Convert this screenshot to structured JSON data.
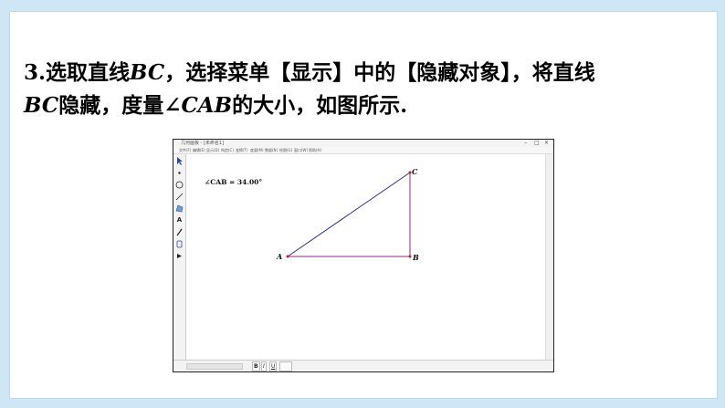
{
  "caption": {
    "num": "3.",
    "t1": "选取直线",
    "bc1": "BC",
    "t2": "，选择菜单【显示】中的【隐藏对象】，将直线",
    "bc2": "BC",
    "t3": "隐藏，度量∠",
    "cab": "CAB",
    "t4": "的大小，如图所示."
  },
  "window": {
    "title": "几何画板 - [未命名1]",
    "minimize": "–",
    "restore": "□",
    "close": "×",
    "menus": [
      "文件(F)",
      "编辑(E)",
      "显示(D)",
      "构造(C)",
      "变换(T)",
      "度量(M)",
      "数据(N)",
      "绘图(G)",
      "窗口(W)",
      "帮助(H)"
    ]
  },
  "tools": {
    "text_tool": "A"
  },
  "measurement": {
    "label": "∠CAB = 34.00°"
  },
  "points": {
    "a": "A",
    "b": "B",
    "c": "C"
  },
  "segment_color": "#2b2b9a",
  "format_bar": {
    "bold": "B",
    "italic": "I",
    "underline": "U"
  }
}
